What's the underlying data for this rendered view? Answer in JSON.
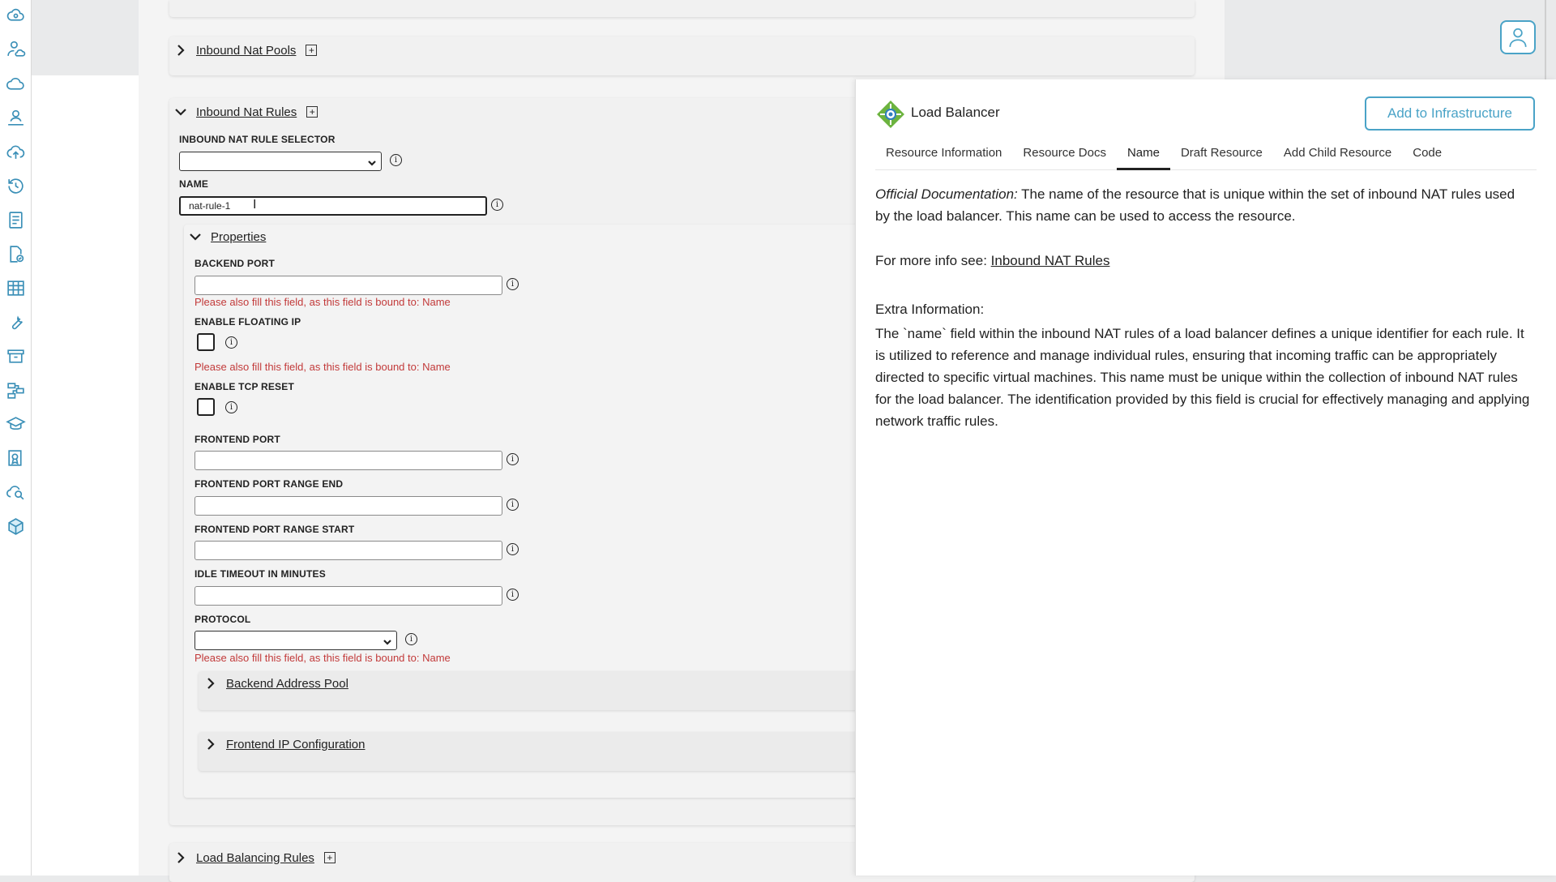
{
  "sections": {
    "inbound_nat_pools": {
      "title": "Inbound Nat Pools",
      "add": "+"
    },
    "inbound_nat_rules": {
      "title": "Inbound Nat Rules",
      "add": "+"
    },
    "load_balancing_rules": {
      "title": "Load Balancing Rules",
      "add": "+"
    }
  },
  "form": {
    "selector_label": "INBOUND NAT RULE SELECTOR",
    "selector_value": "",
    "name_label": "NAME",
    "name_value": "nat-rule-1",
    "properties_title": "Properties",
    "backend_port_label": "BACKEND PORT",
    "enable_floating_ip_label": "ENABLE FLOATING IP",
    "enable_tcp_reset_label": "ENABLE TCP RESET",
    "frontend_port_label": "FRONTEND PORT",
    "frontend_port_range_end_label": "FRONTEND PORT RANGE END",
    "frontend_port_range_start_label": "FRONTEND PORT RANGE START",
    "idle_timeout_label": "IDLE TIMEOUT IN MINUTES",
    "protocol_label": "PROTOCOL",
    "protocol_value": "",
    "bound_error": "Please also fill this field, as this field is bound to: Name",
    "backend_address_pool_title": "Backend Address Pool",
    "frontend_ip_config_title": "Frontend IP Configuration",
    "info_glyph": "i"
  },
  "panel": {
    "title": "Load Balancer",
    "add_button": "Add to Infrastructure",
    "tabs": [
      "Resource Information",
      "Resource Docs",
      "Name",
      "Draft Resource",
      "Add Child Resource",
      "Code"
    ],
    "active_tab": "Name",
    "official_label": "Official Documentation:",
    "official_text": " The name of the resource that is unique within the set of inbound NAT rules used by the load balancer. This name can be used to access the resource.",
    "more_info_label": "For more info see: ",
    "more_info_link": "Inbound NAT Rules",
    "extra_label": "Extra Information:",
    "extra_text": "The `name` field within the inbound NAT rules of a load balancer defines a unique identifier for each rule. It is utilized to reference and manage individual rules, ensuring that incoming traffic can be appropriately directed to specific virtual machines. This name must be unique within the collection of inbound NAT rules for the load balancer. The identification provided by this field is crucial for effectively managing and applying network traffic rules."
  },
  "colors": {
    "accent": "#4aa3c7",
    "error": "#c23a3a",
    "sidebar_icon": "#3a8fb7"
  },
  "sidebar_icons": [
    "cloud-brain-icon",
    "user-cloud-icon",
    "cloud-icon",
    "network-user-icon",
    "cloud-upload-icon",
    "history-icon",
    "document-icon",
    "document-check-icon",
    "table-icon",
    "wrench-icon",
    "archive-icon",
    "workflow-icon",
    "graduation-cap-icon",
    "certificate-icon",
    "cloud-search-icon",
    "cube-icon"
  ]
}
